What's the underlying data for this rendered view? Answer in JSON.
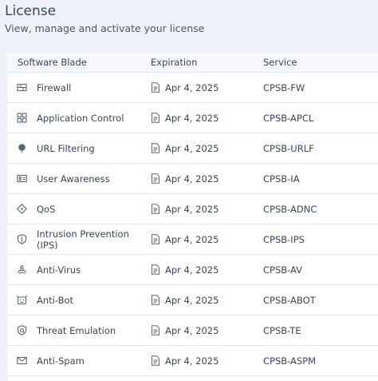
{
  "header": {
    "title": "License",
    "subtitle": "View, manage and activate your license"
  },
  "table": {
    "columns": [
      "Software Blade",
      "Expiration",
      "Service"
    ],
    "rows": [
      {
        "blade": "Firewall",
        "icon": "firewall-icon",
        "expiration": "Apr 4, 2025",
        "service": "CPSB-FW"
      },
      {
        "blade": "Application Control",
        "icon": "application-control-icon",
        "expiration": "Apr 4, 2025",
        "service": "CPSB-APCL"
      },
      {
        "blade": "URL Filtering",
        "icon": "url-filtering-icon",
        "expiration": "Apr 4, 2025",
        "service": "CPSB-URLF"
      },
      {
        "blade": "User Awareness",
        "icon": "user-awareness-icon",
        "expiration": "Apr 4, 2025",
        "service": "CPSB-IA"
      },
      {
        "blade": "QoS",
        "icon": "qos-icon",
        "expiration": "Apr 4, 2025",
        "service": "CPSB-ADNC"
      },
      {
        "blade": "Intrusion Prevention (IPS)",
        "icon": "ips-shield-icon",
        "expiration": "Apr 4, 2025",
        "service": "CPSB-IPS"
      },
      {
        "blade": "Anti-Virus",
        "icon": "anti-virus-icon",
        "expiration": "Apr 4, 2025",
        "service": "CPSB-AV"
      },
      {
        "blade": "Anti-Bot",
        "icon": "anti-bot-icon",
        "expiration": "Apr 4, 2025",
        "service": "CPSB-ABOT"
      },
      {
        "blade": "Threat Emulation",
        "icon": "threat-emulation-icon",
        "expiration": "Apr 4, 2025",
        "service": "CPSB-TE"
      },
      {
        "blade": "Anti-Spam",
        "icon": "anti-spam-icon",
        "expiration": "Apr 4, 2025",
        "service": "CPSB-ASPM"
      }
    ]
  },
  "colors": {
    "background": "#eef2f8",
    "text": "#3a4656",
    "icon": "#5b6675"
  }
}
